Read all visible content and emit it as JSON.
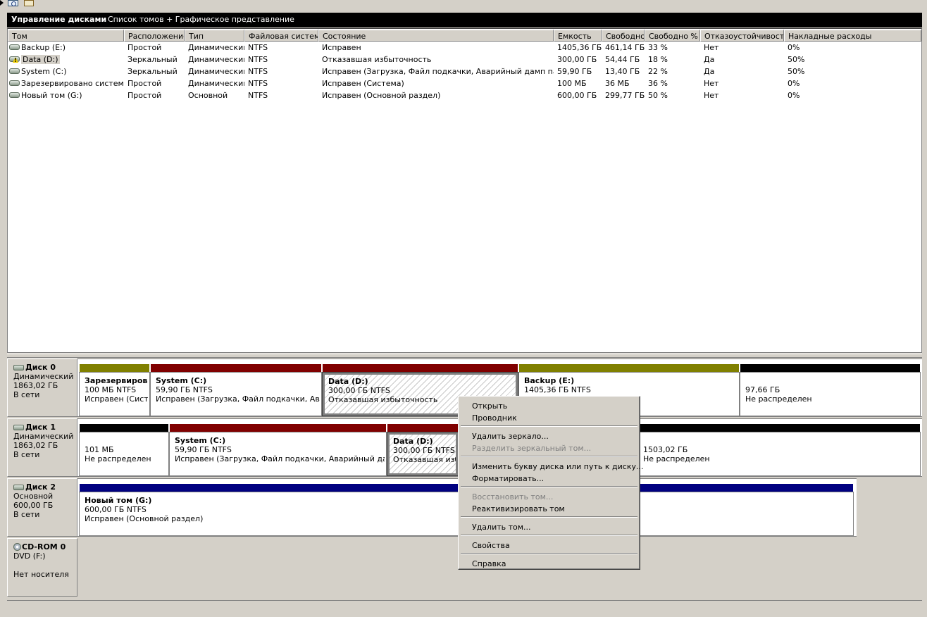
{
  "header": {
    "title": "Управление дисками",
    "view": "Список томов + Графическое представление"
  },
  "volumes_table": {
    "columns": [
      "Том",
      "Расположение",
      "Тип",
      "Файловая система",
      "Состояние",
      "Емкость",
      "Свободно",
      "Свободно %",
      "Отказоустойчивость",
      "Накладные расходы"
    ],
    "rows": [
      {
        "name": "Backup (E:)",
        "layout": "Простой",
        "type": "Динамический",
        "fs": "NTFS",
        "status": "Исправен",
        "capacity": "1405,36 ГБ",
        "free": "461,14 ГБ",
        "free_pct": "33 %",
        "fault_tolerance": "Нет",
        "overhead": "0%",
        "icon": "volume-icon"
      },
      {
        "name": "Data (D:)",
        "layout": "Зеркальный",
        "type": "Динамический",
        "fs": "NTFS",
        "status": "Отказавшая избыточность",
        "capacity": "300,00 ГБ",
        "free": "54,44 ГБ",
        "free_pct": "18 %",
        "fault_tolerance": "Да",
        "overhead": "50%",
        "icon": "volume-warning-icon"
      },
      {
        "name": "System (C:)",
        "layout": "Зеркальный",
        "type": "Динамический",
        "fs": "NTFS",
        "status": "Исправен (Загрузка, Файл подкачки, Аварийный дамп памяти)",
        "capacity": "59,90 ГБ",
        "free": "13,40 ГБ",
        "free_pct": "22 %",
        "fault_tolerance": "Да",
        "overhead": "50%",
        "icon": "volume-icon"
      },
      {
        "name": "Зарезервировано системой",
        "layout": "Простой",
        "type": "Динамический",
        "fs": "NTFS",
        "status": "Исправен (Система)",
        "capacity": "100 МБ",
        "free": "36 МБ",
        "free_pct": "36 %",
        "fault_tolerance": "Нет",
        "overhead": "0%",
        "icon": "volume-icon"
      },
      {
        "name": "Новый том (G:)",
        "layout": "Простой",
        "type": "Основной",
        "fs": "NTFS",
        "status": "Исправен (Основной раздел)",
        "capacity": "600,00 ГБ",
        "free": "299,77 ГБ",
        "free_pct": "50 %",
        "fault_tolerance": "Нет",
        "overhead": "0%",
        "icon": "volume-icon"
      }
    ]
  },
  "disks": [
    {
      "name": "Диск 0",
      "type": "Динамический",
      "size": "1863,02 ГБ",
      "state": "В сети",
      "partitions": [
        {
          "name": "Зарезервирова",
          "size": "100 МБ NTFS",
          "status": "Исправен (Систем",
          "color": "#808000"
        },
        {
          "name": "System  (C:)",
          "size": "59,90 ГБ NTFS",
          "status": "Исправен (Загрузка, Файл подкачки, Аварий",
          "color": "#800000"
        },
        {
          "name": "Data  (D:)",
          "size": "300,00 ГБ NTFS",
          "status": "Отказавшая избыточность",
          "color": "#800000"
        },
        {
          "name": "Backup  (E:)",
          "size": "1405,36 ГБ NTFS",
          "status": "",
          "color": "#808000"
        },
        {
          "name": "",
          "size": "97,66 ГБ",
          "status": "Не распределен",
          "color": "#000000"
        }
      ]
    },
    {
      "name": "Диск 1",
      "type": "Динамический",
      "size": "1863,02 ГБ",
      "state": "В сети",
      "partitions": [
        {
          "name": "",
          "size": "101 МБ",
          "status": "Не распределен",
          "color": "#000000"
        },
        {
          "name": "System  (C:)",
          "size": "59,90 ГБ NTFS",
          "status": "Исправен (Загрузка, Файл подкачки, Аварийный дамп па",
          "color": "#800000"
        },
        {
          "name": "Data  (D:)",
          "size": "300,00 ГБ NTFS",
          "status": "Отказавшая избы",
          "color": "#800000"
        },
        {
          "name": "",
          "size": "1503,02 ГБ",
          "status": "Не распределен",
          "color": "#000000"
        }
      ]
    },
    {
      "name": "Диск 2",
      "type": "Основной",
      "size": "600,00 ГБ",
      "state": "В сети",
      "partitions": [
        {
          "name": "Новый том  (G:)",
          "size": "600,00 ГБ NTFS",
          "status": "Исправен (Основной раздел)",
          "color": "#000080"
        }
      ]
    },
    {
      "name": "CD-ROM 0",
      "type": "DVD (F:)",
      "size": "",
      "state": "Нет носителя",
      "partitions": []
    }
  ],
  "context_menu": {
    "items": [
      {
        "label": "Открыть",
        "enabled": true
      },
      {
        "label": "Проводник",
        "enabled": true
      },
      {
        "label": "Удалить зеркало...",
        "enabled": true
      },
      {
        "label": "Разделить зеркальный том...",
        "enabled": false
      },
      {
        "label": "Изменить букву диска или путь к диску...",
        "enabled": true
      },
      {
        "label": "Форматировать...",
        "enabled": true
      },
      {
        "label": "Восстановить том...",
        "enabled": false
      },
      {
        "label": "Реактивизировать том",
        "enabled": true
      },
      {
        "label": "Удалить том...",
        "enabled": true
      },
      {
        "label": "Свойства",
        "enabled": true
      },
      {
        "label": "Справка",
        "enabled": true
      }
    ]
  },
  "colors": {
    "simple_volume": "#808000",
    "mirrored_volume": "#800000",
    "unallocated": "#000000",
    "primary_partition": "#000080"
  }
}
